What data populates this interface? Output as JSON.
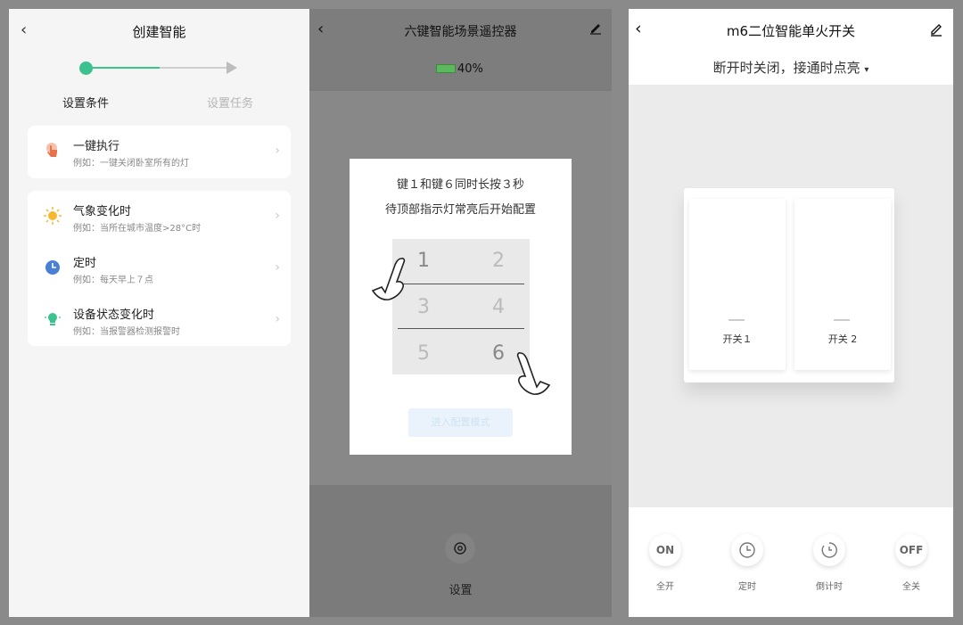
{
  "panel1": {
    "back_glyph": "‹",
    "title": "创建智能",
    "steps": [
      "设置条件",
      "设置任务"
    ],
    "colors": {
      "accent": "#3cc28f",
      "inactive": "#cfcfcf"
    },
    "card1": {
      "items": [
        {
          "icon": "tap-hand-icon",
          "title": "一键执行",
          "subtitle": "例如：一键关闭卧室所有的灯"
        }
      ]
    },
    "card2": {
      "items": [
        {
          "icon": "weather-sun-icon",
          "title": "气象变化时",
          "subtitle": "例如：当所在城市温度>28°C时"
        },
        {
          "icon": "clock-icon",
          "title": "定时",
          "subtitle": "例如：每天早上７点"
        },
        {
          "icon": "device-bulb-icon",
          "title": "设备状态变化时",
          "subtitle": "例如：当报警器检测报警时"
        }
      ]
    },
    "chevron": "›"
  },
  "panel2": {
    "back_glyph": "‹",
    "title": "六键智能场景遥控器",
    "battery": "40%",
    "dialog": {
      "line1": "键１和键６同时长按３秒",
      "line2": "待顶部指示灯常亮后开始配置",
      "keys": [
        "1",
        "2",
        "3",
        "4",
        "5",
        "6"
      ],
      "button_label": "进入配置模式"
    },
    "settings_label": "设置"
  },
  "panel3": {
    "back_glyph": "‹",
    "title": "m6二位智能单火开关",
    "subtitle": "断开时关闭，接通时点亮",
    "subtitle_caret": "▾",
    "switches": [
      "开关１",
      "开关 2"
    ],
    "controls": [
      {
        "icon": "on-icon",
        "text": "ON",
        "label": "全开"
      },
      {
        "icon": "timer-icon",
        "text": "",
        "label": "定时"
      },
      {
        "icon": "countdown-icon",
        "text": "",
        "label": "倒计时"
      },
      {
        "icon": "off-icon",
        "text": "OFF",
        "label": "全关"
      }
    ]
  }
}
